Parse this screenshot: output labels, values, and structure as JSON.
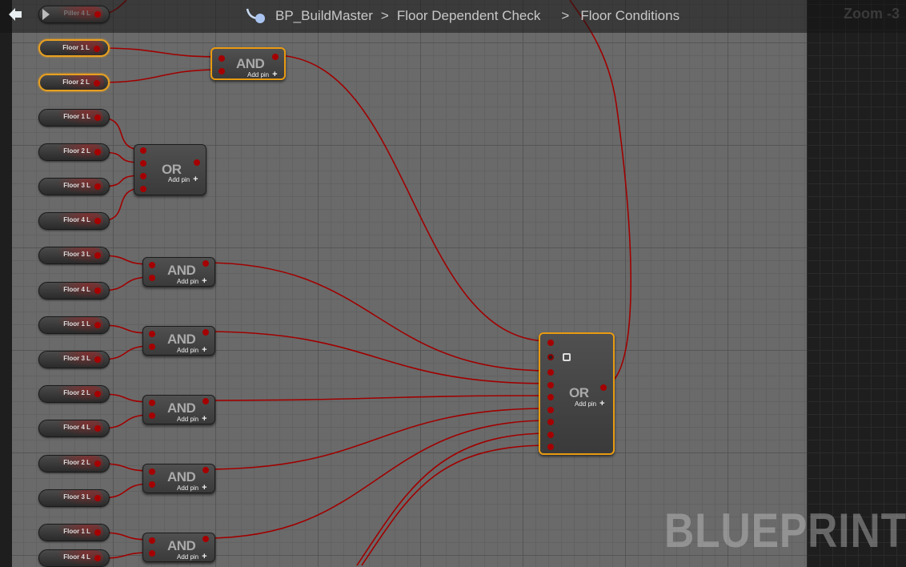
{
  "header": {
    "graph_name": "BP_BuildMaster",
    "breadcrumbs": [
      "BP_BuildMaster",
      "Floor Dependent Check",
      "Floor Conditions"
    ],
    "separator": ">",
    "zoom": "Zoom -3"
  },
  "watermark": "BLUEPRINT",
  "top_node": {
    "label": "Piller 4 L"
  },
  "variables": [
    {
      "label": "Floor 1 L",
      "selected": true
    },
    {
      "label": "Floor 2 L",
      "selected": true
    },
    {
      "label": "Floor 1 L"
    },
    {
      "label": "Floor 2 L"
    },
    {
      "label": "Floor 3 L"
    },
    {
      "label": "Floor 4 L"
    },
    {
      "label": "Floor 3 L"
    },
    {
      "label": "Floor 4 L"
    },
    {
      "label": "Floor 1 L"
    },
    {
      "label": "Floor 3 L"
    },
    {
      "label": "Floor 2 L"
    },
    {
      "label": "Floor 4 L"
    },
    {
      "label": "Floor 2 L"
    },
    {
      "label": "Floor 3 L"
    },
    {
      "label": "Floor 1 L"
    },
    {
      "label": "Floor 4 L"
    }
  ],
  "operators": [
    {
      "title": "AND",
      "add_pin": "Add pin",
      "selected": true
    },
    {
      "title": "OR",
      "add_pin": "Add pin"
    },
    {
      "title": "AND",
      "add_pin": "Add pin"
    },
    {
      "title": "AND",
      "add_pin": "Add pin"
    },
    {
      "title": "AND",
      "add_pin": "Add pin"
    },
    {
      "title": "AND",
      "add_pin": "Add pin"
    },
    {
      "title": "AND",
      "add_pin": "Add pin"
    },
    {
      "title": "OR",
      "add_pin": "Add pin",
      "selected": true
    }
  ],
  "colors": {
    "wire": "#a00000",
    "selection": "#e89a10"
  }
}
